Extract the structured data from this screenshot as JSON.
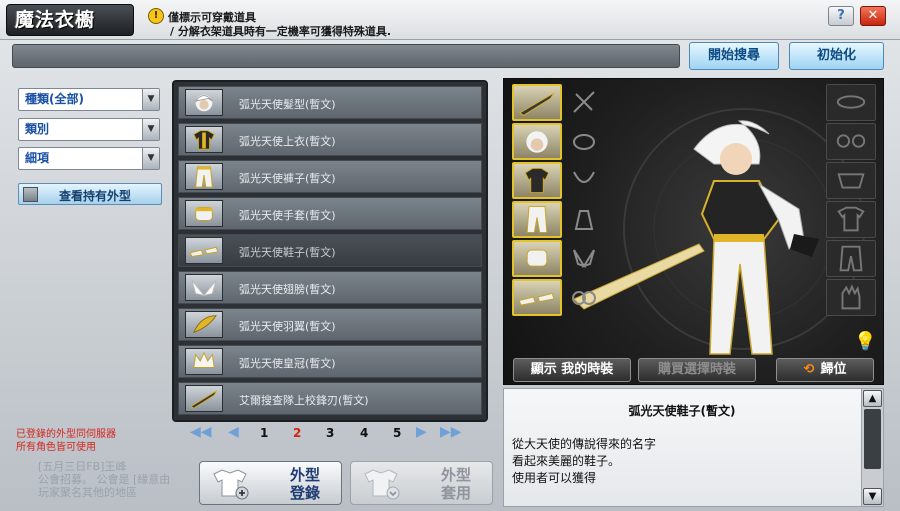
{
  "window": {
    "title": "魔法衣櫥",
    "notice_line1": "僅標示可穿戴道具",
    "notice_line2": "/ 分解衣架道具時有一定機率可獲得特殊道具.",
    "help_label": "?",
    "close_label": "✕"
  },
  "search": {
    "value": "",
    "start_label": "開始搜尋",
    "reset_label": "初始化"
  },
  "filters": {
    "type": "種類(全部)",
    "category": "類別",
    "detail": "細項",
    "owned_toggle_label": "查看持有外型"
  },
  "notes": {
    "registered_line1": "已登錄的外型同伺服器",
    "registered_line2": "所有角色皆可使用",
    "chat_line1": "[五月三日FB]王峰",
    "chat_line2": "公會招募。 公會是 [緣意由",
    "chat_line3": "玩家聚名其他的地區"
  },
  "items": [
    {
      "name": "弧光天使髮型(暫文)",
      "icon": "hair-icon"
    },
    {
      "name": "弧光天使上衣(暫文)",
      "icon": "top-icon"
    },
    {
      "name": "弧光天使褲子(暫文)",
      "icon": "pants-icon"
    },
    {
      "name": "弧光天使手套(暫文)",
      "icon": "gloves-icon"
    },
    {
      "name": "弧光天使鞋子(暫文)",
      "icon": "shoes-icon",
      "selected": true
    },
    {
      "name": "弧光天使翅膀(暫文)",
      "icon": "wings-icon"
    },
    {
      "name": "弧光天使羽翼(暫文)",
      "icon": "feather-icon"
    },
    {
      "name": "弧光天使皇冠(暫文)",
      "icon": "crown-icon"
    },
    {
      "name": "艾爾搜查隊上校鋒刃(暫文)",
      "icon": "blade-icon"
    }
  ],
  "pager": {
    "pages": [
      "1",
      "2",
      "3",
      "4",
      "5"
    ],
    "current": "2"
  },
  "buttons": {
    "register_line1": "外型",
    "register_line2": "登錄",
    "apply_line1": "外型",
    "apply_line2": "套用"
  },
  "preview": {
    "show_mine_label": "顯示 我的時裝",
    "buy_selected_label": "購買選擇時裝",
    "reset_label": "歸位"
  },
  "description": {
    "title": "弧光天使鞋子(暫文)",
    "line1": "從大天使的傳說得來的名字",
    "line2": "看起來美麗的鞋子。",
    "line3": "使用者可以獲得"
  },
  "colors": {
    "accent_blue": "#1950a6",
    "current_page_red": "#d42019",
    "slot_gold": "#e2c42a"
  }
}
